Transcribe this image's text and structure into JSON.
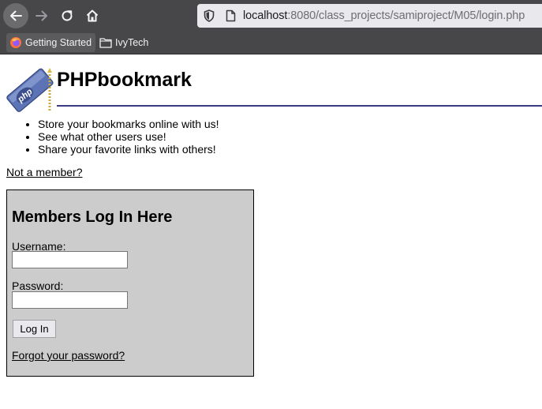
{
  "browser": {
    "url_host": "localhost",
    "url_path": ":8080/class_projects/samiproject/M05/login.php",
    "bookmarks": [
      {
        "label": "Getting Started",
        "icon": "firefox-icon"
      },
      {
        "label": "IvyTech",
        "icon": "folder-icon"
      }
    ]
  },
  "header": {
    "logo_text": "php",
    "title": "PHPbookmark"
  },
  "features": [
    "Store your bookmarks online with us!",
    "See what other users use!",
    "Share your favorite links with others!"
  ],
  "register_link": "Not a member?",
  "login": {
    "heading": "Members Log In Here",
    "username_label": "Username:",
    "username_value": "",
    "password_label": "Password:",
    "password_value": "",
    "submit_label": "Log In",
    "forgot_link": "Forgot your password?"
  },
  "colors": {
    "chrome": "#474749",
    "urlbar": "#e9e9ed",
    "title_rule": "#3b3b84",
    "login_box": "#cccccc"
  }
}
